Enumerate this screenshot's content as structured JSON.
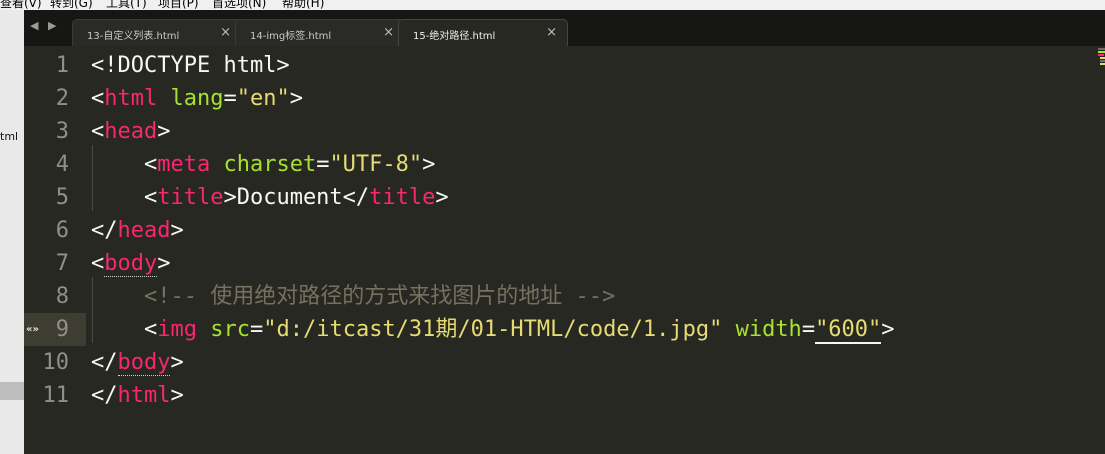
{
  "menubar": {
    "items": [
      "查看(V)",
      "转到(G)",
      "工具(T)",
      "项目(P)",
      "首选项(N)",
      "帮助(H)"
    ]
  },
  "sidebar": {
    "label": "tml"
  },
  "tabs": [
    {
      "label": "13-自定义列表.html",
      "active": false
    },
    {
      "label": "14-img标签.html",
      "active": false
    },
    {
      "label": "15-绝对路径.html",
      "active": true
    }
  ],
  "tab_close_glyph": "×",
  "nav_arrows": "◀ ▶",
  "editor": {
    "current_line": 9,
    "fold_marker": "«»",
    "lines": [
      {
        "number": "1",
        "segments": [
          [
            "pt",
            "<!DOCTYPE html>"
          ]
        ]
      },
      {
        "number": "2",
        "segments": [
          [
            "pt",
            "<"
          ],
          [
            "tg",
            "html"
          ],
          [
            "pt",
            " "
          ],
          [
            "at",
            "lang"
          ],
          [
            "pt",
            "="
          ],
          [
            "st",
            "\"en\""
          ],
          [
            "pt",
            ">"
          ]
        ]
      },
      {
        "number": "3",
        "segments": [
          [
            "pt",
            "<"
          ],
          [
            "tg",
            "head"
          ],
          [
            "pt",
            ">"
          ]
        ]
      },
      {
        "number": "4",
        "segments": [
          [
            "pt",
            "    <"
          ],
          [
            "tg",
            "meta"
          ],
          [
            "pt",
            " "
          ],
          [
            "at",
            "charset"
          ],
          [
            "pt",
            "="
          ],
          [
            "st",
            "\"UTF-8\""
          ],
          [
            "pt",
            ">"
          ]
        ]
      },
      {
        "number": "5",
        "segments": [
          [
            "pt",
            "    <"
          ],
          [
            "tg",
            "title"
          ],
          [
            "pt",
            ">Document</"
          ],
          [
            "tg",
            "title"
          ],
          [
            "pt",
            ">"
          ]
        ]
      },
      {
        "number": "6",
        "segments": [
          [
            "pt",
            "</"
          ],
          [
            "tg",
            "head"
          ],
          [
            "pt",
            ">"
          ]
        ]
      },
      {
        "number": "7",
        "segments": [
          [
            "pt",
            "<"
          ],
          [
            "tg",
            "body"
          ],
          [
            "pt",
            ">"
          ]
        ]
      },
      {
        "number": "8",
        "segments": [
          [
            "cm",
            "    <!-- 使用绝对路径的方式来找图片的地址 -->"
          ]
        ]
      },
      {
        "number": "9",
        "segments": [
          [
            "pt",
            "    <"
          ],
          [
            "tg",
            "img"
          ],
          [
            "pt",
            " "
          ],
          [
            "at",
            "src"
          ],
          [
            "pt",
            "="
          ],
          [
            "st",
            "\"d:/itcast/31期/01-HTML/code/1.jpg\""
          ],
          [
            "pt",
            " "
          ],
          [
            "at",
            "width"
          ],
          [
            "pt",
            "="
          ],
          [
            "st",
            "\"600\""
          ],
          [
            "pt",
            ">"
          ]
        ]
      },
      {
        "number": "10",
        "segments": [
          [
            "pt",
            "</"
          ],
          [
            "tg",
            "body"
          ],
          [
            "pt",
            ">"
          ]
        ]
      },
      {
        "number": "11",
        "segments": [
          [
            "pt",
            "</"
          ],
          [
            "tg",
            "html"
          ],
          [
            "pt",
            ">"
          ]
        ]
      }
    ]
  },
  "colors": {
    "background": "#272822",
    "tag": "#f92672",
    "attribute": "#a6e22e",
    "string": "#e6db74",
    "comment": "#75715e",
    "plain": "#f8f8f2",
    "line_number": "#8f908a"
  }
}
